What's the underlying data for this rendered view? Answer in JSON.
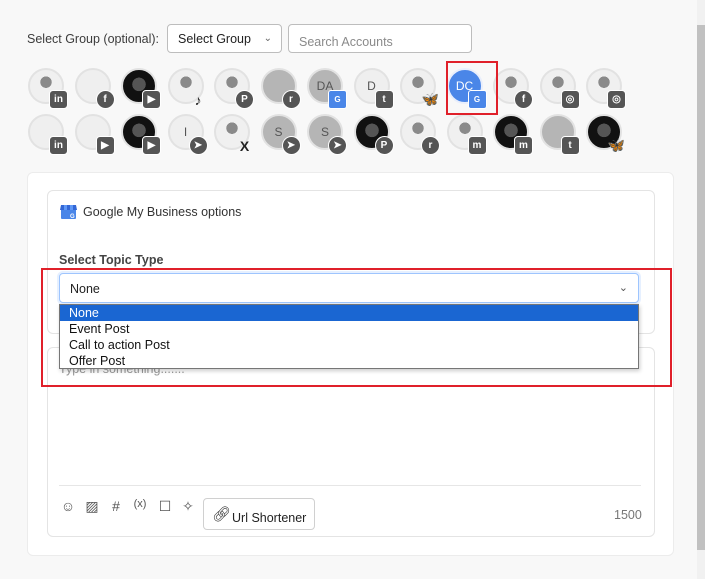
{
  "header": {
    "group_label": "Select Group (optional):",
    "group_select_value": "Select Group",
    "search_placeholder": "Search Accounts"
  },
  "accounts": [
    {
      "avatar": "photo",
      "initials": "",
      "network": "linkedin",
      "badge": "in",
      "selected": false
    },
    {
      "avatar": "light",
      "initials": "",
      "network": "facebook",
      "badge": "f",
      "selected": false
    },
    {
      "avatar": "dark",
      "initials": "",
      "network": "youtube",
      "badge": "▶",
      "selected": false
    },
    {
      "avatar": "photo",
      "initials": "",
      "network": "tiktok",
      "badge": "♪",
      "selected": false
    },
    {
      "avatar": "photo",
      "initials": "",
      "network": "pinterest",
      "badge": "P",
      "selected": false
    },
    {
      "avatar": "gray",
      "initials": "",
      "network": "reddit",
      "badge": "r",
      "selected": false
    },
    {
      "avatar": "gray",
      "initials": "DA",
      "network": "google-my-business",
      "badge": "G",
      "selected": false
    },
    {
      "avatar": "light",
      "initials": "D",
      "network": "tumblr",
      "badge": "t",
      "selected": false
    },
    {
      "avatar": "photo",
      "initials": "",
      "network": "bluesky",
      "badge": "🦋",
      "selected": false
    },
    {
      "avatar": "blue",
      "initials": "DC",
      "network": "google-my-business",
      "badge": "G",
      "selected": true
    },
    {
      "avatar": "photo",
      "initials": "",
      "network": "facebook",
      "badge": "f",
      "selected": false
    },
    {
      "avatar": "photo",
      "initials": "",
      "network": "instagram",
      "badge": "◎",
      "selected": false
    },
    {
      "avatar": "photo",
      "initials": "",
      "network": "instagram",
      "badge": "◎",
      "selected": false
    },
    {
      "avatar": "light",
      "initials": "",
      "network": "linkedin",
      "badge": "in",
      "selected": false
    },
    {
      "avatar": "light",
      "initials": "",
      "network": "youtube",
      "badge": "▶",
      "selected": false
    },
    {
      "avatar": "dark",
      "initials": "",
      "network": "youtube",
      "badge": "▶",
      "selected": false
    },
    {
      "avatar": "light",
      "initials": "I",
      "network": "telegram",
      "badge": "➤",
      "selected": false
    },
    {
      "avatar": "photo",
      "initials": "",
      "network": "x",
      "badge": "X",
      "selected": false
    },
    {
      "avatar": "gray",
      "initials": "S",
      "network": "telegram",
      "badge": "➤",
      "selected": false
    },
    {
      "avatar": "gray",
      "initials": "S",
      "network": "telegram",
      "badge": "➤",
      "selected": false
    },
    {
      "avatar": "dark",
      "initials": "",
      "network": "pinterest",
      "badge": "P",
      "selected": false
    },
    {
      "avatar": "photo",
      "initials": "",
      "network": "reddit",
      "badge": "r",
      "selected": false
    },
    {
      "avatar": "photo",
      "initials": "",
      "network": "mastodon",
      "badge": "m",
      "selected": false
    },
    {
      "avatar": "dark",
      "initials": "",
      "network": "mastodon",
      "badge": "m",
      "selected": false
    },
    {
      "avatar": "gray",
      "initials": "",
      "network": "tumblr",
      "badge": "t",
      "selected": false
    },
    {
      "avatar": "dark",
      "initials": "",
      "network": "bluesky",
      "badge": "🦋",
      "selected": false
    }
  ],
  "gmb": {
    "title": "Google My Business options",
    "topic_label": "Select Topic Type",
    "topic_value": "None",
    "topic_options": [
      "None",
      "Event Post",
      "Call to action Post",
      "Offer Post"
    ],
    "active_option": "None"
  },
  "editor": {
    "placeholder": "Type in something.......",
    "url_shortener_label": "Url Shortener",
    "char_count": "1500",
    "tools": [
      {
        "name": "emoji-icon",
        "glyph": "☺"
      },
      {
        "name": "image-icon",
        "glyph": "▨"
      },
      {
        "name": "hashtag-icon",
        "glyph": "#"
      },
      {
        "name": "variable-icon",
        "glyph": "(x)"
      },
      {
        "name": "template-icon",
        "glyph": "☐"
      },
      {
        "name": "ai-sparkle-icon",
        "glyph": "✧"
      }
    ]
  },
  "colors": {
    "highlight_red": "#e0202a",
    "option_active": "#1a66d2",
    "gmb_blue": "#4a86e8"
  }
}
